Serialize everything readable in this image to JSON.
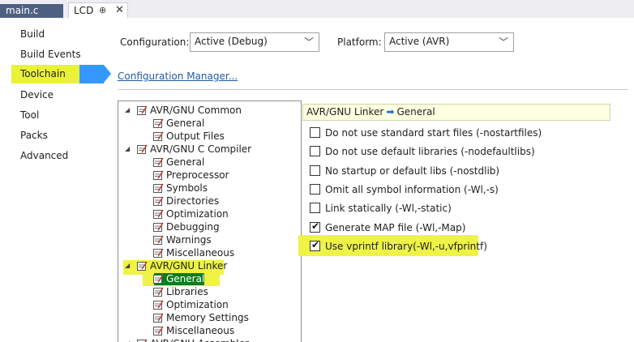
{
  "tabs": {
    "main_label": "main.c",
    "lcd_label": "LCD",
    "pin_glyph": "⊕",
    "close_glyph": "✕"
  },
  "nav": {
    "items": [
      "Build",
      "Build Events",
      "Toolchain",
      "Device",
      "Tool",
      "Packs",
      "Advanced"
    ],
    "active": "Toolchain"
  },
  "config": {
    "configuration_label": "Configuration:",
    "configuration_value": "Active (Debug)",
    "platform_label": "Platform:",
    "platform_value": "Active (AVR)",
    "manager_link": "Configuration Manager..."
  },
  "tree": {
    "nodes": [
      {
        "label": "AVR/GNU Common",
        "level": 0
      },
      {
        "label": "General",
        "level": 1
      },
      {
        "label": "Output Files",
        "level": 1
      },
      {
        "label": "AVR/GNU C Compiler",
        "level": 0
      },
      {
        "label": "General",
        "level": 1
      },
      {
        "label": "Preprocessor",
        "level": 1
      },
      {
        "label": "Symbols",
        "level": 1
      },
      {
        "label": "Directories",
        "level": 1
      },
      {
        "label": "Optimization",
        "level": 1
      },
      {
        "label": "Debugging",
        "level": 1
      },
      {
        "label": "Warnings",
        "level": 1
      },
      {
        "label": "Miscellaneous",
        "level": 1
      },
      {
        "label": "AVR/GNU Linker",
        "level": 0
      },
      {
        "label": "General",
        "level": 1
      },
      {
        "label": "Libraries",
        "level": 1
      },
      {
        "label": "Optimization",
        "level": 1
      },
      {
        "label": "Memory Settings",
        "level": 1
      },
      {
        "label": "Miscellaneous",
        "level": 1
      },
      {
        "label": "AVR/GNU Assembler",
        "level": 0
      }
    ],
    "selected": "AVR/GNU Linker > General"
  },
  "panel": {
    "crumb_parent": "AVR/GNU Linker",
    "crumb_arrow": "➡",
    "crumb_child": "General",
    "options": [
      {
        "label": "Do not use standard start files (-nostartfiles)",
        "checked": false
      },
      {
        "label": "Do not use default libraries (-nodefaultlibs)",
        "checked": false
      },
      {
        "label": "No startup or default libs (-nostdlib)",
        "checked": false
      },
      {
        "label": "Omit all symbol information (-Wl,-s)",
        "checked": false
      },
      {
        "label": "Link statically (-Wl,-static)",
        "checked": false
      },
      {
        "label": "Generate MAP file (-Wl,-Map)",
        "checked": true
      },
      {
        "label": "Use vprintf library(-Wl,-u,vfprintf)",
        "checked": true
      }
    ]
  },
  "colors": {
    "accent": "#3399ff",
    "highlight": "#eef346",
    "tab_active": "#4d6082",
    "selection": "#0f7b1a",
    "link": "#1e5aa8"
  },
  "icons": {
    "property_page": "property-page-icon",
    "checkmark": "checkmark-icon",
    "expander": "expander-triangle-icon",
    "dropdown": "chevron-down-icon"
  }
}
